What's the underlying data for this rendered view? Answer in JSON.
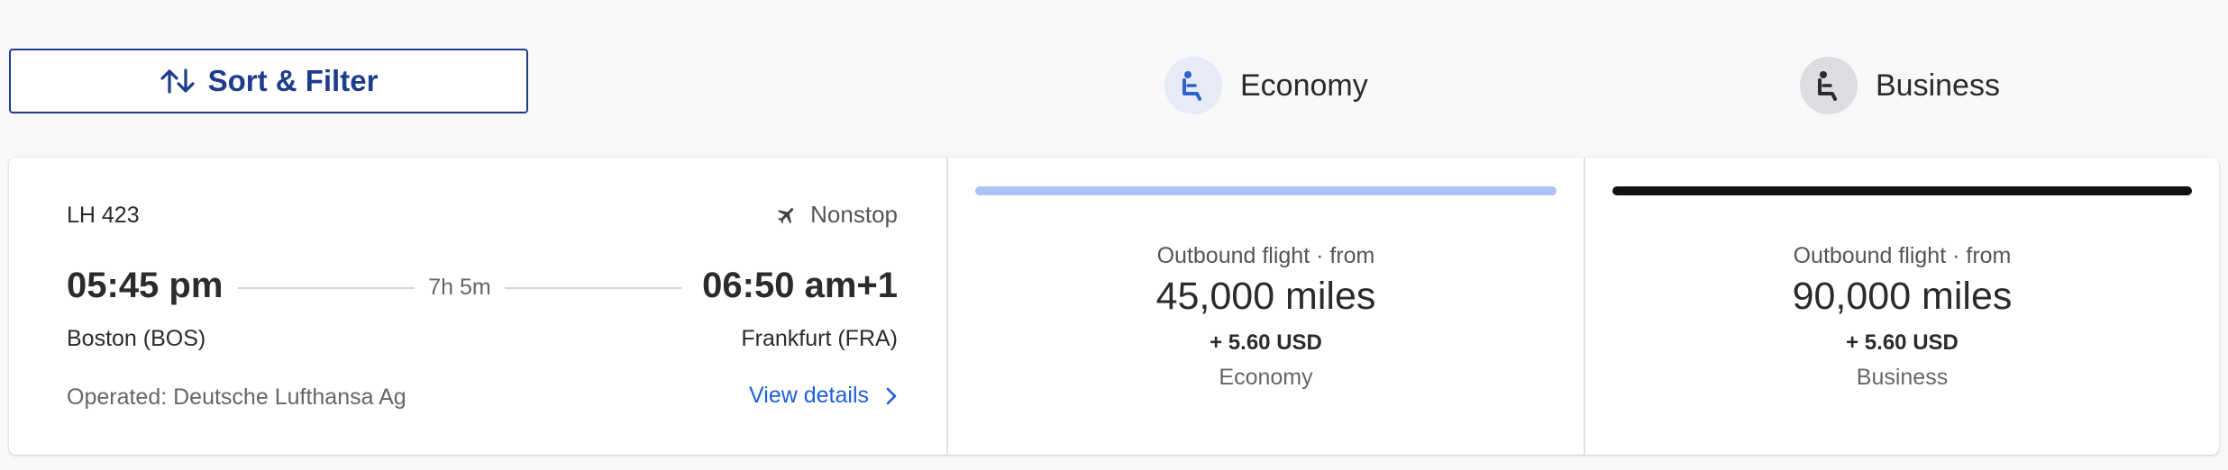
{
  "toolbar": {
    "sort_label": "Sort & Filter"
  },
  "cabins": {
    "economy": {
      "label": "Economy"
    },
    "business": {
      "label": "Business"
    }
  },
  "flight": {
    "number": "LH 423",
    "stops": "Nonstop",
    "departure_time": "05:45 pm",
    "arrival_time": "06:50 am+1",
    "duration": "7h 5m",
    "origin": "Boston (BOS)",
    "destination": "Frankfurt (FRA)",
    "operated_by": "Operated: Deutsche Lufthansa Ag",
    "view_details_label": "View details"
  },
  "fares": {
    "economy": {
      "heading": "Outbound flight · from",
      "miles": "45,000 miles",
      "usd": "+ 5.60 USD",
      "cabin": "Economy",
      "bar_color": "#a9c3f5"
    },
    "business": {
      "heading": "Outbound flight · from",
      "miles": "90,000 miles",
      "usd": "+ 5.60 USD",
      "cabin": "Business",
      "bar_color": "#111111"
    }
  },
  "colors": {
    "accent": "#1c3c8c",
    "link": "#1c5fd6"
  }
}
